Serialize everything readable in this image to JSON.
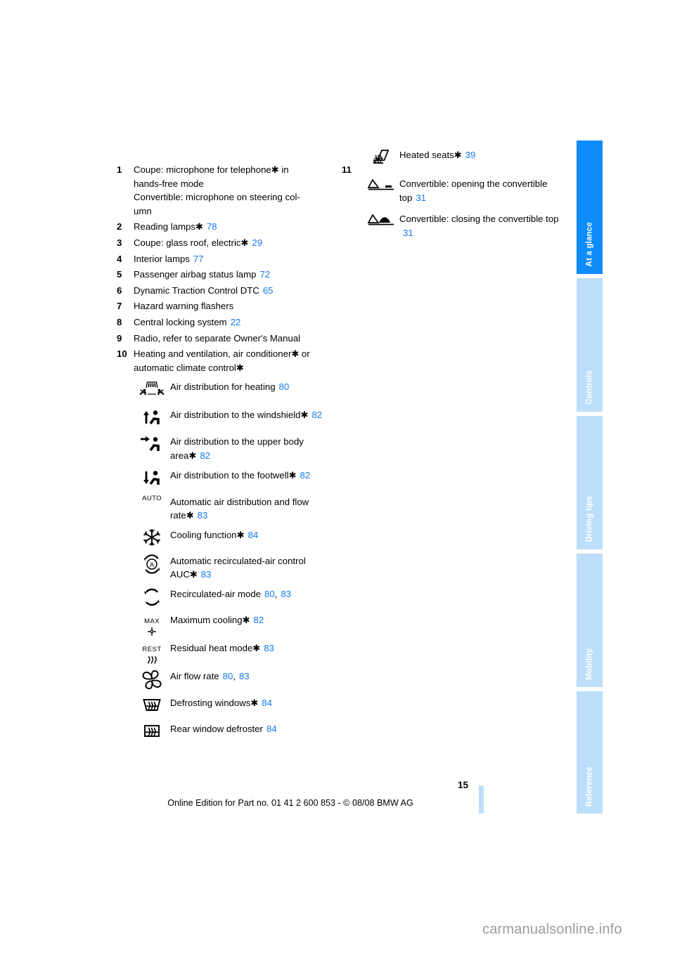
{
  "page": {
    "number": "15",
    "footer_note": "Online Edition for Part no. 01 41 2 600 853 - © 08/08 BMW AG",
    "watermark": "carmanualsonline.info",
    "link_color": "#1379f0",
    "tab_active_color": "#0d8bfb",
    "tab_inactive_color": "#bcdefb"
  },
  "tabs": [
    {
      "label": "At a glance",
      "active": true
    },
    {
      "label": "Controls",
      "active": false
    },
    {
      "label": "Driving tips",
      "active": false
    },
    {
      "label": "Mobility",
      "active": false
    },
    {
      "label": "Reference",
      "active": false
    }
  ],
  "left_column": {
    "items": [
      {
        "index": "1",
        "lines": [
          "Coupe: microphone for telephone* in",
          "hands-free mode",
          "Convertible: microphone on steering col-",
          "umn"
        ]
      },
      {
        "index": "2",
        "text": "Reading lamps*",
        "page": "78"
      },
      {
        "index": "3",
        "text": "Coupe: glass roof, electric*",
        "page": "29"
      },
      {
        "index": "4",
        "text": "Interior lamps",
        "page": "77"
      },
      {
        "index": "5",
        "text": "Passenger airbag status lamp",
        "page": "72"
      },
      {
        "index": "6",
        "text": "Dynamic Traction Control DTC",
        "page": "65"
      },
      {
        "index": "7",
        "text": "Hazard warning flashers",
        "page": ""
      },
      {
        "index": "8",
        "text": "Central locking system",
        "page": "22"
      },
      {
        "index": "9",
        "text": "Radio, refer to separate Owner's Manual",
        "page": ""
      },
      {
        "index": "10",
        "lines": [
          "Heating and ventilation, air conditioner* or",
          "automatic climate control*"
        ]
      }
    ],
    "icon_rows": [
      {
        "icon": "air-distribution-heating-icon",
        "label": "Air distribution for heating",
        "pages": [
          "80"
        ]
      },
      {
        "icon": "air-distribution-windshield-icon",
        "label": "Air distribution to the windshield*",
        "pages": [
          "82"
        ]
      },
      {
        "icon": "air-distribution-upper-body-icon",
        "label": "Air distribution to the upper body area*",
        "pages": [
          "82"
        ]
      },
      {
        "icon": "air-distribution-footwell-icon",
        "label": "Air distribution to the footwell*",
        "pages": [
          "82"
        ]
      },
      {
        "icon": "auto-icon",
        "icon_text": "AUTO",
        "label": "Automatic air distribution and flow rate*",
        "pages": [
          "83"
        ]
      },
      {
        "icon": "cooling-snowflake-icon",
        "label": "Cooling function*",
        "pages": [
          "84"
        ]
      },
      {
        "icon": "auc-recirculated-air-icon",
        "label": "Automatic recirculated-air control AUC*",
        "pages": [
          "83"
        ]
      },
      {
        "icon": "recirculated-air-mode-icon",
        "label": "Recirculated-air mode",
        "pages": [
          "80",
          "83"
        ]
      },
      {
        "icon": "max-cooling-icon",
        "icon_text": "MAX",
        "label": "Maximum cooling*",
        "pages": [
          "82"
        ]
      },
      {
        "icon": "residual-heat-icon",
        "icon_text": "REST",
        "label": "Residual heat mode*",
        "pages": [
          "83"
        ]
      },
      {
        "icon": "air-flow-rate-fan-icon",
        "label": "Air flow rate",
        "pages": [
          "80",
          "83"
        ]
      },
      {
        "icon": "defrosting-windows-icon",
        "label": "Defrosting windows*",
        "pages": [
          "84"
        ]
      },
      {
        "icon": "rear-window-defroster-icon",
        "label": "Rear window defroster",
        "pages": [
          "84"
        ]
      }
    ]
  },
  "right_column": {
    "index": "11",
    "icon_rows": [
      {
        "icon": "heated-seat-icon",
        "label": "Heated seats*",
        "pages": [
          "39"
        ]
      },
      {
        "icon": "convertible-top-open-icon",
        "label": "Convertible: opening the convertible top",
        "pages": [
          "31"
        ]
      },
      {
        "icon": "convertible-top-close-icon",
        "label": "Convertible: closing the convertible top",
        "pages": [
          "31"
        ]
      }
    ]
  }
}
